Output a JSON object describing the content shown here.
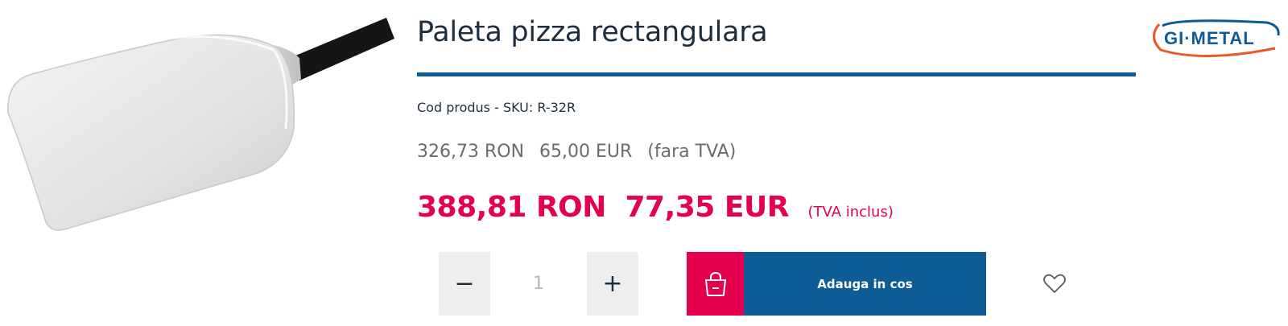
{
  "product": {
    "title": "Paleta pizza rectangulara",
    "sku_label": "Cod produs - SKU:",
    "sku_value": "R-32R",
    "image_alt": "pizza-peel-image"
  },
  "brand": {
    "name": "GI·METAL"
  },
  "price_net": {
    "ron": "326,73 RON",
    "eur": "65,00 EUR",
    "note": "(fara TVA)"
  },
  "price_gross": {
    "ron": "388,81 RON",
    "eur": "77,35 EUR",
    "note": "(TVA inclus)"
  },
  "quantity": {
    "minus": "−",
    "plus": "+",
    "value": "1"
  },
  "cart": {
    "label": "Adauga in cos"
  },
  "icons": {
    "cart": "shopping-bag-icon",
    "wishlist": "heart-icon"
  },
  "colors": {
    "accent": "#e5004f",
    "primary": "#0d5c96",
    "brand_orange": "#e8592a"
  }
}
